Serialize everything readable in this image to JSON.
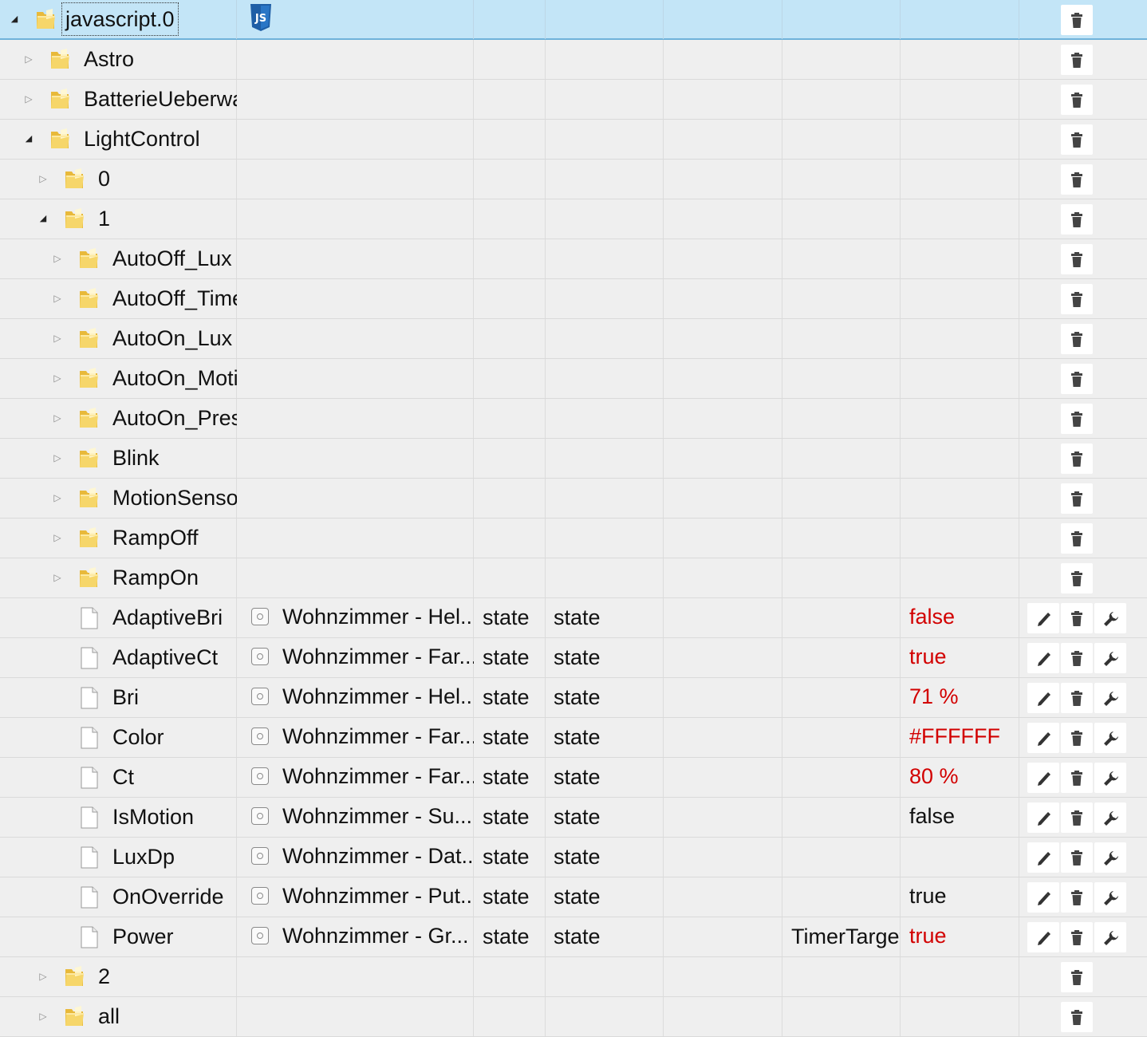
{
  "root": {
    "label": "javascript.0"
  },
  "rows": [
    {
      "label": "Astro"
    },
    {
      "label": "BatterieUeberwa"
    },
    {
      "label": "LightControl"
    },
    {
      "label": "0"
    },
    {
      "label": "1"
    },
    {
      "label": "AutoOff_Lux"
    },
    {
      "label": "AutoOff_Time"
    },
    {
      "label": "AutoOn_Lux"
    },
    {
      "label": "AutoOn_Moti"
    },
    {
      "label": "AutoOn_Prese"
    },
    {
      "label": "Blink"
    },
    {
      "label": "MotionSensor"
    },
    {
      "label": "RampOff"
    },
    {
      "label": "RampOn"
    },
    {
      "label": "AdaptiveBri",
      "name": "Wohnzimmer - Hel...",
      "type": "state",
      "role": "state",
      "room": "",
      "value": "false",
      "valueColor": "#d20000"
    },
    {
      "label": "AdaptiveCt",
      "name": "Wohnzimmer - Far...",
      "type": "state",
      "role": "state",
      "room": "",
      "value": "true",
      "valueColor": "#d20000"
    },
    {
      "label": "Bri",
      "name": "Wohnzimmer - Hel...",
      "type": "state",
      "role": "state",
      "room": "",
      "value": "71 %",
      "valueColor": "#d20000"
    },
    {
      "label": "Color",
      "name": "Wohnzimmer - Far...",
      "type": "state",
      "role": "state",
      "room": "",
      "value": "#FFFFFF",
      "valueColor": "#d20000"
    },
    {
      "label": "Ct",
      "name": "Wohnzimmer - Far...",
      "type": "state",
      "role": "state",
      "room": "",
      "value": "80 %",
      "valueColor": "#d20000"
    },
    {
      "label": "IsMotion",
      "name": "Wohnzimmer - Su...",
      "type": "state",
      "role": "state",
      "room": "",
      "value": "false",
      "valueColor": "#111111"
    },
    {
      "label": "LuxDp",
      "name": "Wohnzimmer - Dat...",
      "type": "state",
      "role": "state",
      "room": "",
      "value": "",
      "valueColor": "#111111"
    },
    {
      "label": "OnOverride",
      "name": "Wohnzimmer - Put...",
      "type": "state",
      "role": "state",
      "room": "",
      "value": "true",
      "valueColor": "#111111"
    },
    {
      "label": "Power",
      "name": "Wohnzimmer - Gr...",
      "type": "state",
      "role": "state",
      "room": "TimerTarget",
      "value": "true",
      "valueColor": "#d20000"
    },
    {
      "label": "2"
    },
    {
      "label": "all"
    }
  ],
  "icons": {
    "expand": "triangle-right-icon",
    "collapse": "triangle-down-icon",
    "folder": "folder-icon",
    "file": "file-icon",
    "state_role": "state-icon",
    "adapter": "javascript-icon",
    "delete": "trash-icon",
    "edit": "pencil-icon",
    "settings": "wrench-icon"
  },
  "colors": {
    "selected_bg": "#c3e5f7",
    "value_changed": "#d20000",
    "row_bg": "#efefef"
  }
}
